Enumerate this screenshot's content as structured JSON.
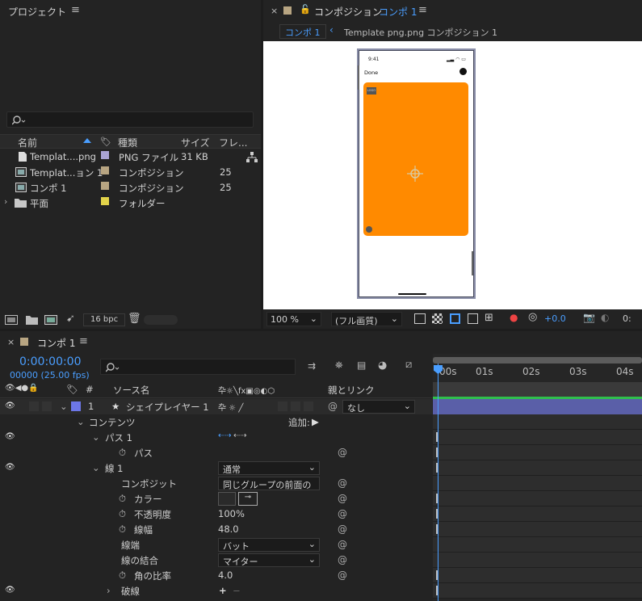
{
  "project": {
    "title": "プロジェクト",
    "columns": {
      "name": "名前",
      "type": "種類",
      "size": "サイズ",
      "frames": "フレ..."
    },
    "items": [
      {
        "name": "Templat....png",
        "type": "PNG ファイル",
        "size": "31 KB",
        "frames": "",
        "color": "#a9a3d4"
      },
      {
        "name": "Templat...ョン 1",
        "type": "コンポジション",
        "size": "",
        "frames": "25",
        "color": "#b8a582"
      },
      {
        "name": "コンポ 1",
        "type": "コンポジション",
        "size": "",
        "frames": "25",
        "color": "#b8a582"
      },
      {
        "name": "平面",
        "type": "フォルダー",
        "size": "",
        "frames": "",
        "color": "#e2d34a"
      }
    ],
    "bpc": "16 bpc"
  },
  "viewer": {
    "panel_label": "コンポジション",
    "comp_name": "コンポ 1",
    "breadcrumb_active": "コンポ 1",
    "breadcrumb_other": "Template png.png コンポジション 1",
    "phone": {
      "time": "9:41",
      "done": "Done",
      "logo": "LOGO",
      "card_color": "#ff8a00"
    },
    "zoom": "100 %",
    "resolution": "(フル画質)",
    "exposure": "+0.0",
    "timecode_short": "0:"
  },
  "timeline": {
    "tab": "コンポ 1",
    "timecode": "0:00:00:00",
    "frames": "00000 (25.00 fps)",
    "col_hash": "#",
    "col_source": "ソース名",
    "col_parent": "親とリンク",
    "ruler": [
      "00s",
      "01s",
      "02s",
      "03s",
      "04s"
    ],
    "layer": {
      "num": "1",
      "name": "シェイプレイヤー 1",
      "parent": "なし"
    },
    "contents": "コンテンツ",
    "add": "追加:",
    "path_group": "パス 1",
    "path": "パス",
    "stroke_group": "線 1",
    "stroke_blend": "通常",
    "composite_label": "コンポジット",
    "composite_value": "同じグループの前面の",
    "color_label": "カラー",
    "opacity_label": "不透明度",
    "opacity_value": "100",
    "opacity_unit": "%",
    "width_label": "線幅",
    "width_value": "48.0",
    "cap_label": "線端",
    "cap_value": "バット",
    "join_label": "線の結合",
    "join_value": "マイター",
    "miter_label": "角の比率",
    "miter_value": "4.0",
    "dash_label": "破線"
  }
}
